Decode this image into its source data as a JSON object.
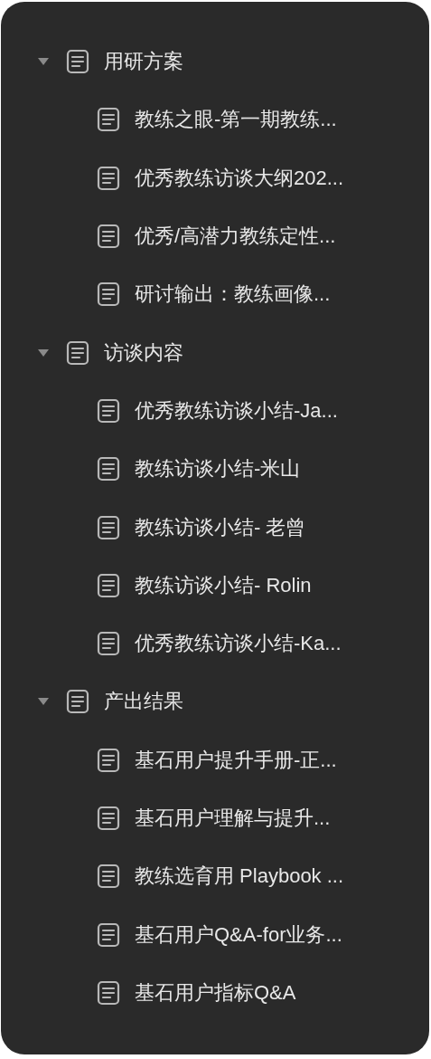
{
  "tree": [
    {
      "label": "用研方案",
      "expanded": true,
      "children": [
        {
          "label": "教练之眼-第一期教练..."
        },
        {
          "label": "优秀教练访谈大纲202..."
        },
        {
          "label": "优秀/高潜力教练定性..."
        },
        {
          "label": "研讨输出：教练画像..."
        }
      ]
    },
    {
      "label": "访谈内容",
      "expanded": true,
      "children": [
        {
          "label": "优秀教练访谈小结-Ja..."
        },
        {
          "label": "教练访谈小结-米山"
        },
        {
          "label": "教练访谈小结- 老曾"
        },
        {
          "label": "教练访谈小结- Rolin"
        },
        {
          "label": "优秀教练访谈小结-Ka..."
        }
      ]
    },
    {
      "label": "产出结果",
      "expanded": true,
      "children": [
        {
          "label": "基石用户提升手册-正..."
        },
        {
          "label": "基石用户理解与提升..."
        },
        {
          "label": "教练选育用 Playbook ..."
        },
        {
          "label": "基石用户Q&A-for业务..."
        },
        {
          "label": "基石用户指标Q&A"
        }
      ]
    }
  ]
}
